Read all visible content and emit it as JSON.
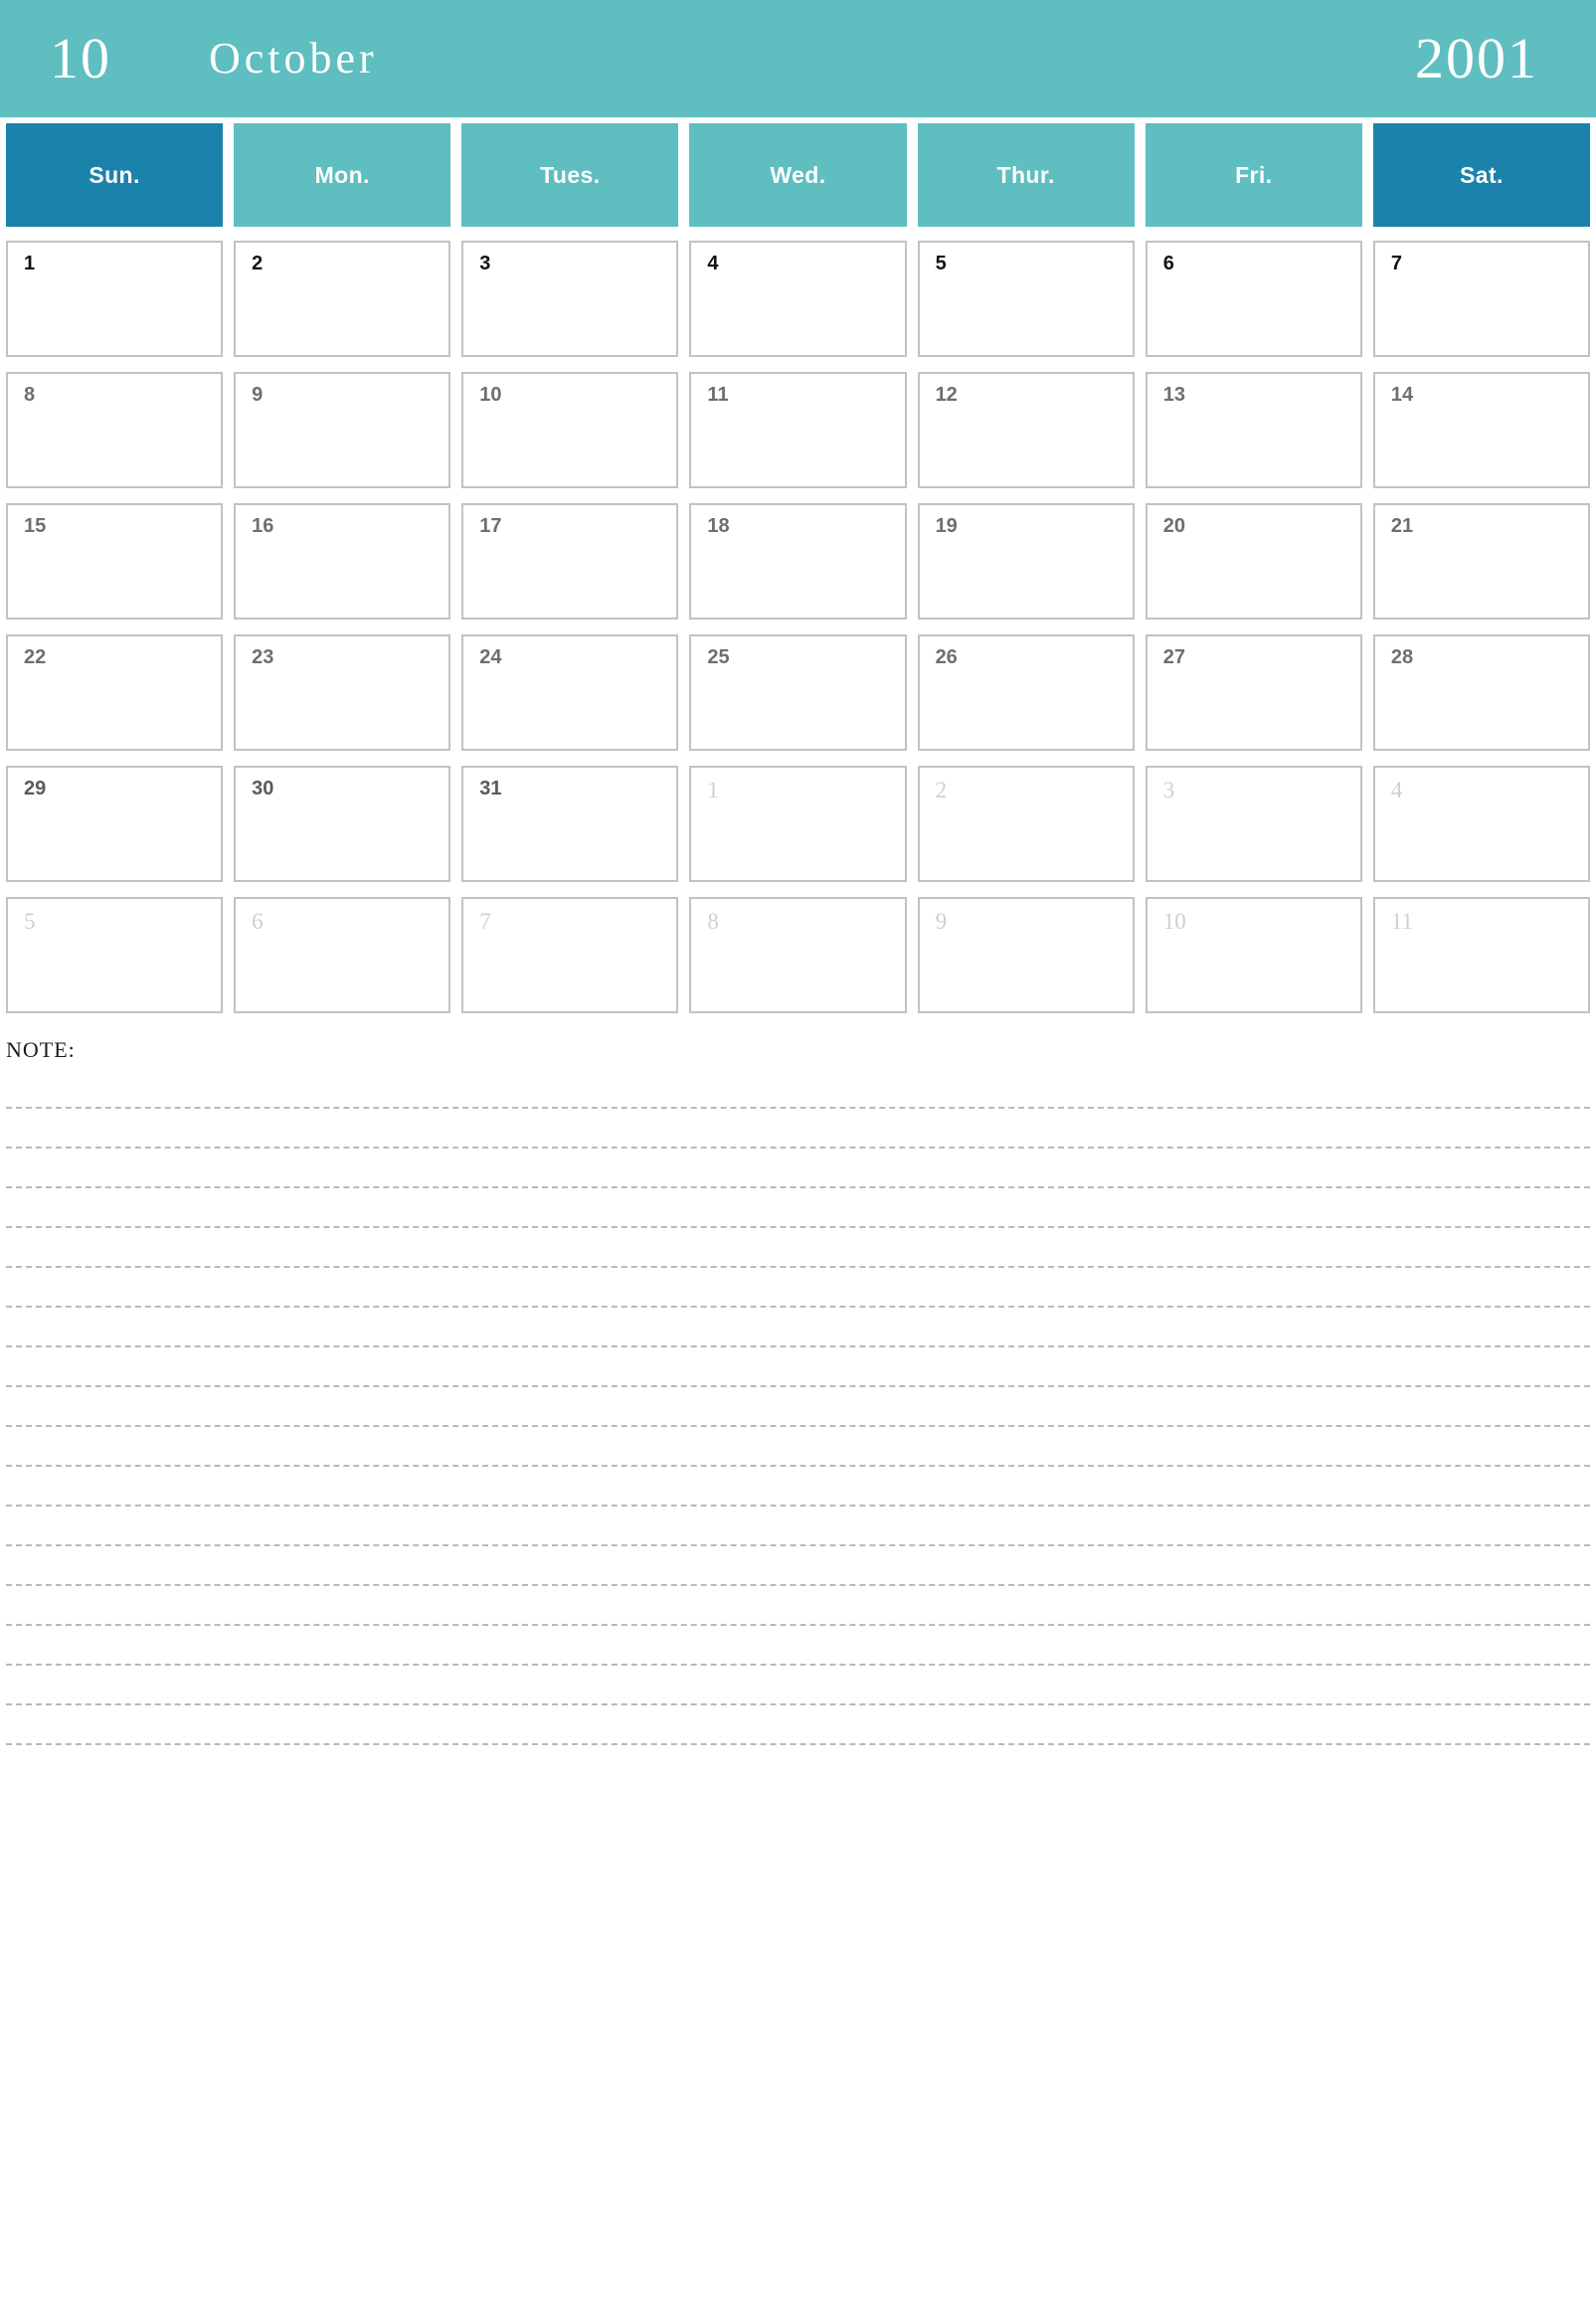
{
  "banner": {
    "month_number": "10",
    "month_name": "October",
    "year": "2001",
    "background_color": "#5ebec0",
    "text_color": "#ffffff"
  },
  "weekdays": [
    {
      "label": "Sun.",
      "weekend": true,
      "color": "#1a82ab"
    },
    {
      "label": "Mon.",
      "weekend": false,
      "color": "#5ebec0"
    },
    {
      "label": "Tues.",
      "weekend": false,
      "color": "#5ebec0"
    },
    {
      "label": "Wed.",
      "weekend": false,
      "color": "#5ebec0"
    },
    {
      "label": "Thur.",
      "weekend": false,
      "color": "#5ebec0"
    },
    {
      "label": "Fri.",
      "weekend": false,
      "color": "#5ebec0"
    },
    {
      "label": "Sat.",
      "weekend": true,
      "color": "#1a82ab"
    }
  ],
  "weeks": [
    [
      {
        "day": "1",
        "tone": "strong"
      },
      {
        "day": "2",
        "tone": "strong"
      },
      {
        "day": "3",
        "tone": "strong"
      },
      {
        "day": "4",
        "tone": "strong"
      },
      {
        "day": "5",
        "tone": "strong"
      },
      {
        "day": "6",
        "tone": "strong"
      },
      {
        "day": "7",
        "tone": "strong"
      }
    ],
    [
      {
        "day": "8",
        "tone": "mid"
      },
      {
        "day": "9",
        "tone": "mid"
      },
      {
        "day": "10",
        "tone": "mid"
      },
      {
        "day": "11",
        "tone": "mid"
      },
      {
        "day": "12",
        "tone": "mid"
      },
      {
        "day": "13",
        "tone": "mid"
      },
      {
        "day": "14",
        "tone": "mid"
      }
    ],
    [
      {
        "day": "15",
        "tone": "mid"
      },
      {
        "day": "16",
        "tone": "mid"
      },
      {
        "day": "17",
        "tone": "mid"
      },
      {
        "day": "18",
        "tone": "mid"
      },
      {
        "day": "19",
        "tone": "mid"
      },
      {
        "day": "20",
        "tone": "mid"
      },
      {
        "day": "21",
        "tone": "mid"
      }
    ],
    [
      {
        "day": "22",
        "tone": "mid"
      },
      {
        "day": "23",
        "tone": "mid"
      },
      {
        "day": "24",
        "tone": "mid"
      },
      {
        "day": "25",
        "tone": "mid"
      },
      {
        "day": "26",
        "tone": "mid"
      },
      {
        "day": "27",
        "tone": "mid"
      },
      {
        "day": "28",
        "tone": "mid"
      }
    ],
    [
      {
        "day": "29",
        "tone": "dark"
      },
      {
        "day": "30",
        "tone": "dark"
      },
      {
        "day": "31",
        "tone": "dark"
      },
      {
        "day": "1",
        "tone": "out"
      },
      {
        "day": "2",
        "tone": "out"
      },
      {
        "day": "3",
        "tone": "out"
      },
      {
        "day": "4",
        "tone": "out"
      }
    ],
    [
      {
        "day": "5",
        "tone": "out"
      },
      {
        "day": "6",
        "tone": "out"
      },
      {
        "day": "7",
        "tone": "out"
      },
      {
        "day": "8",
        "tone": "out"
      },
      {
        "day": "9",
        "tone": "out"
      },
      {
        "day": "10",
        "tone": "out"
      },
      {
        "day": "11",
        "tone": "out"
      }
    ]
  ],
  "note": {
    "title": "NOTE:",
    "line_count": 17
  }
}
